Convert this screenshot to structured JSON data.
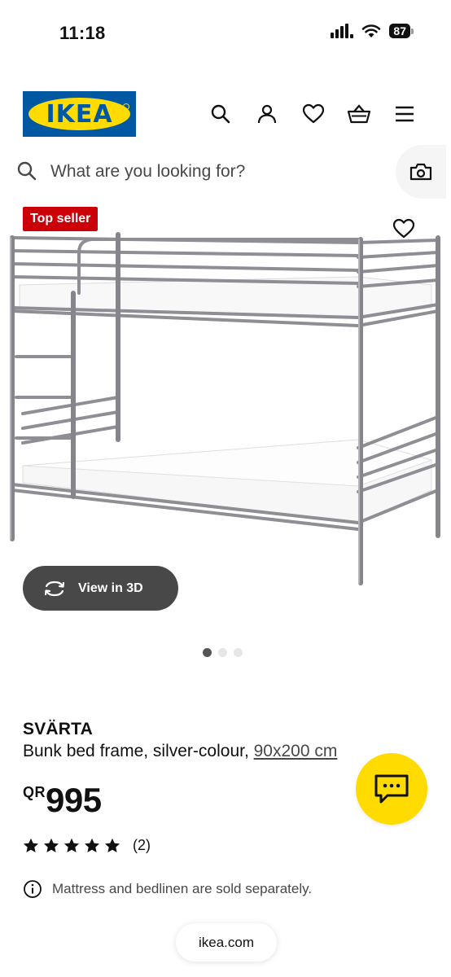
{
  "status_bar": {
    "time": "11:18",
    "battery": "87",
    "icons": [
      "cellular-signal-icon",
      "wifi-icon",
      "battery-icon"
    ]
  },
  "header": {
    "logo_text": "IKEA",
    "icons": [
      "search-icon",
      "profile-icon",
      "heart-icon",
      "shopping-basket-icon",
      "menu-icon"
    ],
    "brand_colors": {
      "blue": "#0058a3",
      "yellow": "#ffdb00"
    }
  },
  "search": {
    "placeholder": "What are you looking for?",
    "camera_icon": "camera-search-icon"
  },
  "gallery": {
    "badge": "Top seller",
    "badge_color": "#cc0008",
    "view_3d_label": "View in 3D",
    "image_count": 3,
    "active_image": 1
  },
  "product": {
    "name": "SVÄRTA",
    "description": "Bunk bed frame, silver-colour, ",
    "size": "90x200 cm",
    "currency": "QR",
    "price": "995",
    "rating": 5,
    "review_count": "(2)",
    "note": "Mattress and bedlinen are sold separately."
  },
  "browser": {
    "url": "ikea.com"
  }
}
